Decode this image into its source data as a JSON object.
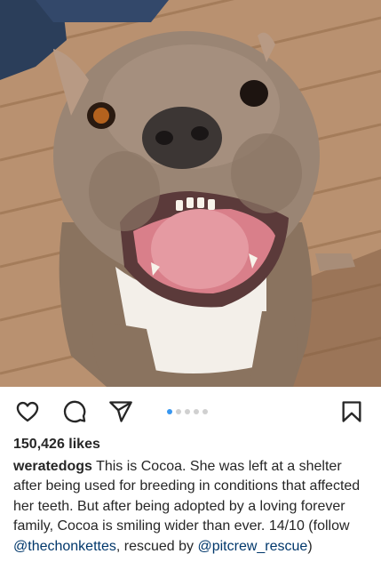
{
  "post": {
    "photo_alt": "smiling dog photo",
    "carousel": {
      "count": 5,
      "active_index": 0,
      "active_color": "#3897f0",
      "inactive_color": "#d0d0d0"
    },
    "likes": "150,426 likes",
    "caption": {
      "username": "weratedogs",
      "text_1": "This is Cocoa. She was left at a shelter after being used for breeding in conditions that affected her teeth. But after being adopted by a loving forever family, Cocoa is smiling wider than ever. 14/10 (follow",
      "mention_1": "@thechonkettes",
      "text_2": ", rescued by",
      "mention_2": "@pitcrew_rescue",
      "text_3": ")"
    },
    "icons": {
      "like": "heart-icon",
      "comment": "comment-icon",
      "share": "send-icon",
      "save": "bookmark-icon"
    }
  }
}
